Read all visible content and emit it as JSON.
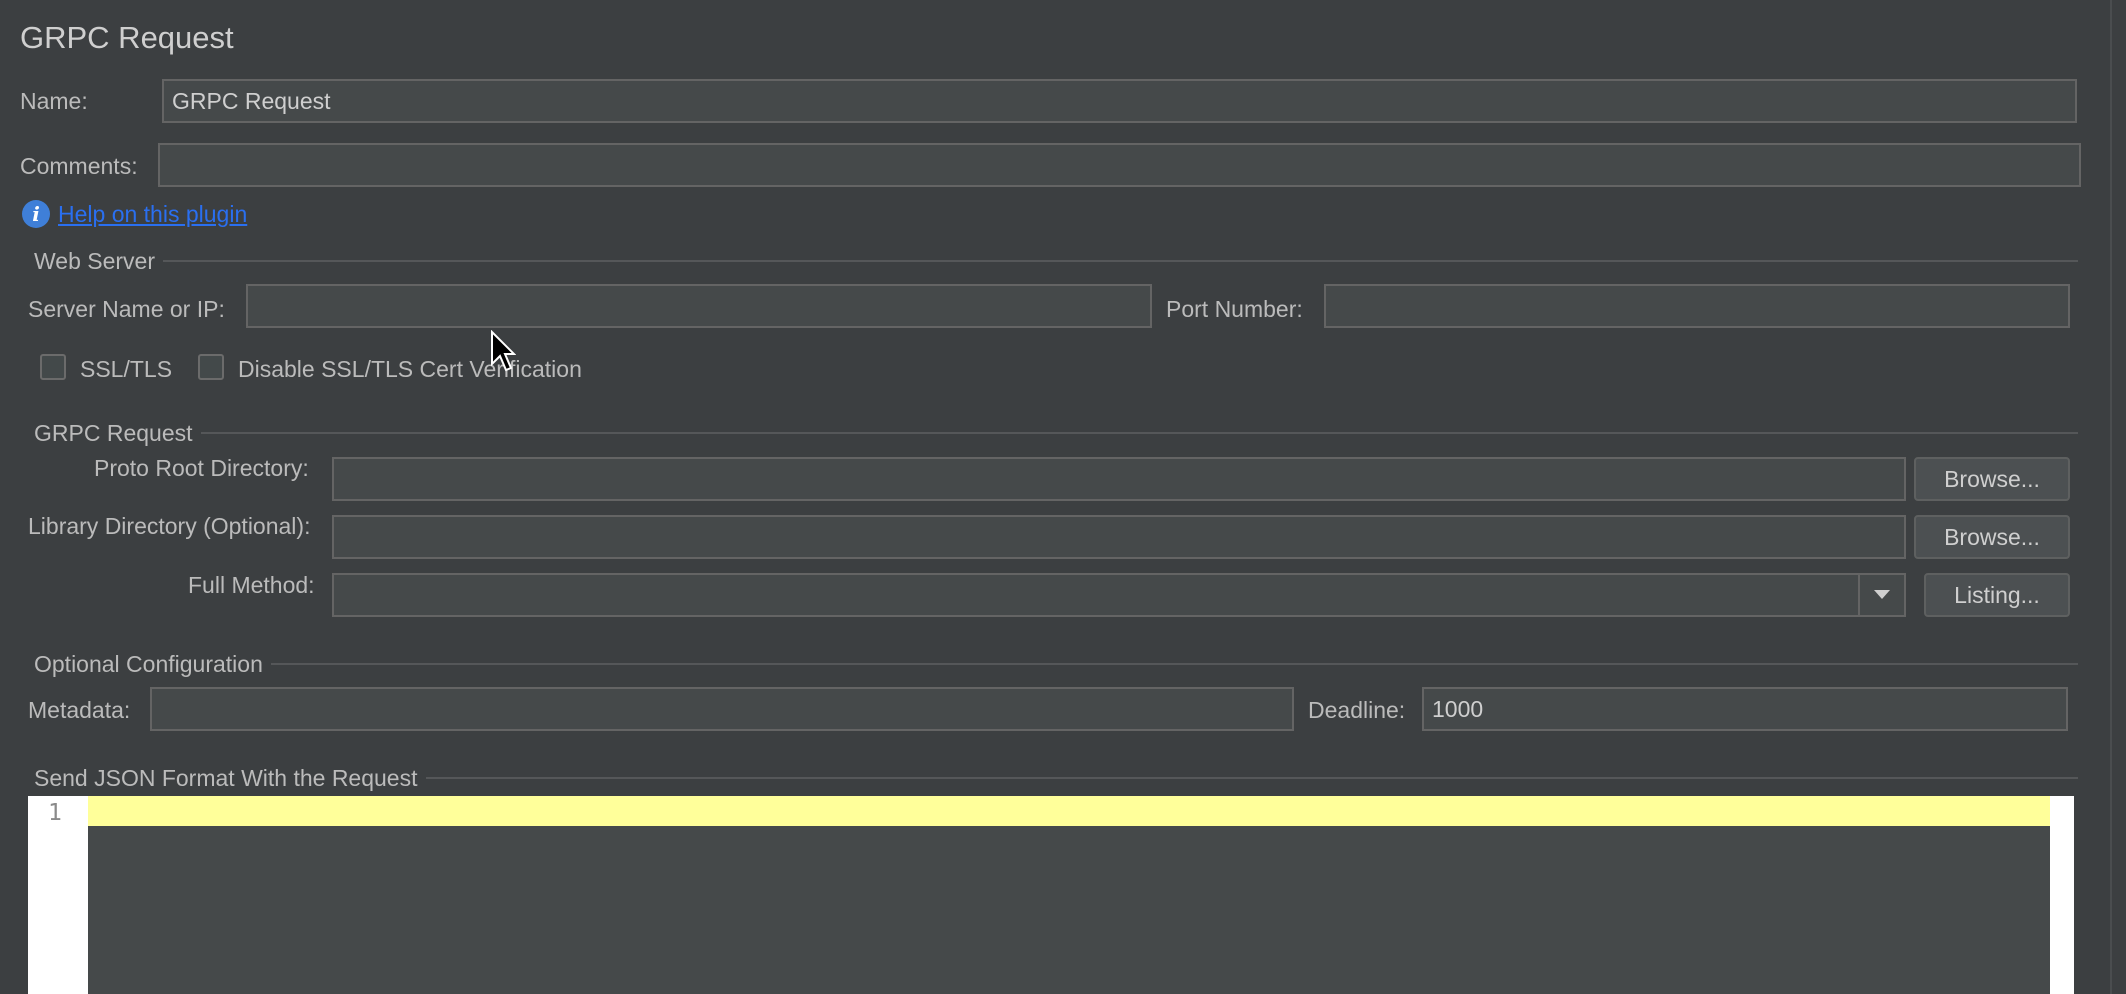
{
  "panel": {
    "title": "GRPC Request"
  },
  "name": {
    "label": "Name:",
    "value": "GRPC Request"
  },
  "comments": {
    "label": "Comments:",
    "value": ""
  },
  "help": {
    "link_text": "Help on this plugin",
    "icon": "info-icon"
  },
  "web_server": {
    "title": "Web Server",
    "server_label": "Server Name or IP:",
    "server_value": "",
    "port_label": "Port Number:",
    "port_value": "",
    "ssl_label": "SSL/TLS",
    "ssl_checked": false,
    "disable_ssl_label": "Disable SSL/TLS Cert Verification",
    "disable_ssl_checked": false
  },
  "grpc_request": {
    "title": "GRPC Request",
    "proto_label": "Proto Root Directory:",
    "proto_value": "",
    "proto_browse": "Browse...",
    "library_label": "Library Directory (Optional):",
    "library_value": "",
    "library_browse": "Browse...",
    "method_label": "Full Method:",
    "method_value": "",
    "listing_button": "Listing..."
  },
  "optional_config": {
    "title": "Optional Configuration",
    "metadata_label": "Metadata:",
    "metadata_value": "",
    "deadline_label": "Deadline:",
    "deadline_value": "1000"
  },
  "json_section": {
    "title": "Send JSON Format With the Request",
    "line_number": "1"
  },
  "colors": {
    "background": "#3c3f41",
    "field": "#45494a",
    "link": "#2a6ff0",
    "current_line": "#ffff9a"
  }
}
